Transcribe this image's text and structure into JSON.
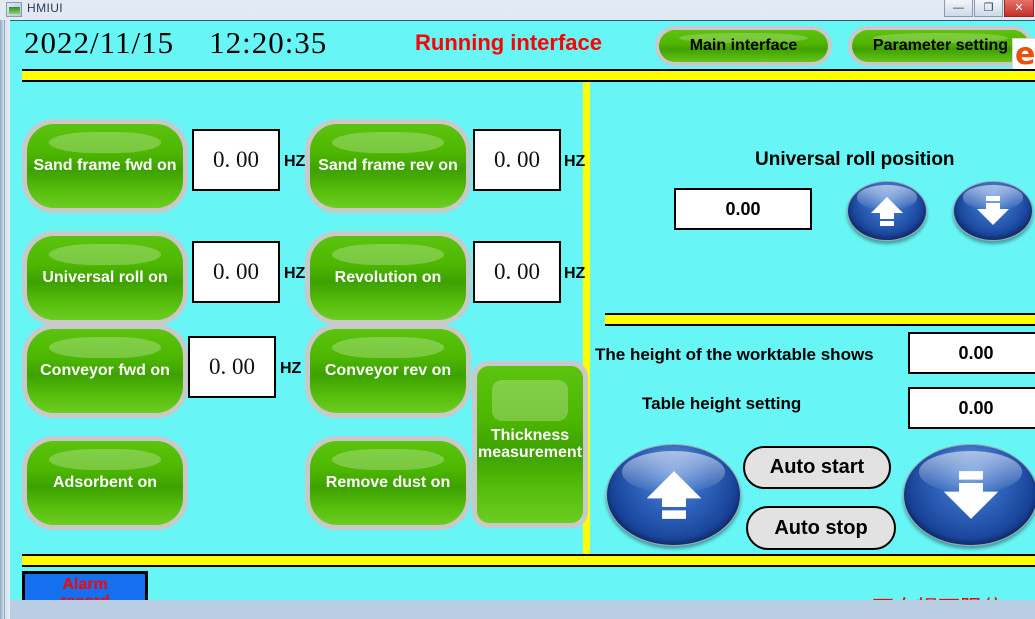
{
  "window": {
    "title": "HMIUI",
    "icon": "app-icon",
    "minimize_label": "—",
    "maximize_label": "❐",
    "close_label": "✕"
  },
  "header": {
    "date": "2022/11/15",
    "time": "12:20:35",
    "datetime": "2022/11/15    12:20:35",
    "screen_title": "Running interface",
    "nav_buttons": [
      {
        "label": "Main interface",
        "name": "main-interface-button"
      },
      {
        "label": "Parameter setting",
        "name": "parameter-setting-button"
      }
    ],
    "corner_icon_glyph": "e"
  },
  "left_panel": {
    "hz_unit": "HZ",
    "controls": [
      {
        "label": "Sand frame fwd on",
        "value": "0. 00",
        "unit": "HZ"
      },
      {
        "label": "Sand frame rev on",
        "value": "0. 00",
        "unit": "HZ"
      },
      {
        "label": "Universal roll on",
        "value": "0. 00",
        "unit": "HZ"
      },
      {
        "label": "Revolution on",
        "value": "0. 00",
        "unit": "HZ"
      },
      {
        "label": "Conveyor fwd on",
        "value": "0. 00",
        "unit": "HZ"
      },
      {
        "label": "Conveyor rev on",
        "value": "",
        "unit": ""
      },
      {
        "label": "Adsorbent on",
        "value": "",
        "unit": ""
      },
      {
        "label": "Remove dust on",
        "value": "",
        "unit": ""
      }
    ],
    "thickness_button": "Thickness measurement"
  },
  "right_panel": {
    "universal_roll": {
      "title": "Universal roll position",
      "value": "0.00",
      "up_icon": "arrow-up-icon",
      "down_icon": "arrow-down-icon"
    },
    "worktable": {
      "height_show_label": "The height of the worktable shows",
      "height_show_value": "0.00",
      "height_set_label": "Table height setting",
      "height_set_value": "0.00",
      "auto_start_label": "Auto start",
      "auto_stop_label": "Auto stop",
      "up_icon": "arrow-up-icon",
      "down_icon": "arrow-down-icon"
    }
  },
  "footer": {
    "alarm_record_label": "Alarm\nrecord",
    "alarm_record_line1": "Alarm",
    "alarm_record_line2": "record",
    "alarm_message": "万向辊下限位"
  },
  "colors": {
    "screen_background": "#67f5f5",
    "accent_yellow": "#ffff00",
    "button_green": "#4cb600",
    "button_blue": "#1f58b5",
    "alarm_red": "#ff0000",
    "alarm_button_blue": "#1570ef"
  }
}
